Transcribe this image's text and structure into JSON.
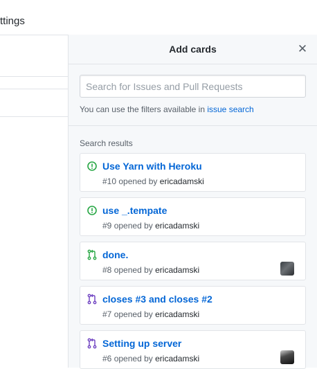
{
  "background": {
    "tab_label": "ttings"
  },
  "drawer": {
    "title": "Add cards",
    "close_symbol": "✕",
    "search": {
      "placeholder": "Search for Issues and Pull Requests",
      "value": "",
      "hint_text": "You can use the filters available in ",
      "hint_link": "issue search"
    },
    "results_heading": "Search results",
    "results": [
      {
        "type": "issue-open",
        "icon": "issue-opened-icon",
        "title": "Use Yarn with Heroku",
        "number": "#10",
        "opened_by": "opened by",
        "author": "ericadamski",
        "has_avatar": false
      },
      {
        "type": "issue-open",
        "icon": "issue-opened-icon",
        "title": "use _.tempate",
        "number": "#9",
        "opened_by": "opened by",
        "author": "ericadamski",
        "has_avatar": false
      },
      {
        "type": "pr-open",
        "icon": "pull-request-icon",
        "title": "done.",
        "number": "#8",
        "opened_by": "opened by",
        "author": "ericadamski",
        "has_avatar": true
      },
      {
        "type": "pr-merged",
        "icon": "pull-request-icon",
        "title": "closes #3 and closes #2",
        "number": "#7",
        "opened_by": "opened by",
        "author": "ericadamski",
        "has_avatar": false
      },
      {
        "type": "pr-merged",
        "icon": "pull-request-icon",
        "title": "Setting up server",
        "number": "#6",
        "opened_by": "opened by",
        "author": "ericadamski",
        "has_avatar": true
      }
    ]
  },
  "colors": {
    "issue_open": "#28a745",
    "pr_open": "#28a745",
    "pr_merged": "#6f42c1",
    "link": "#0366d6"
  }
}
